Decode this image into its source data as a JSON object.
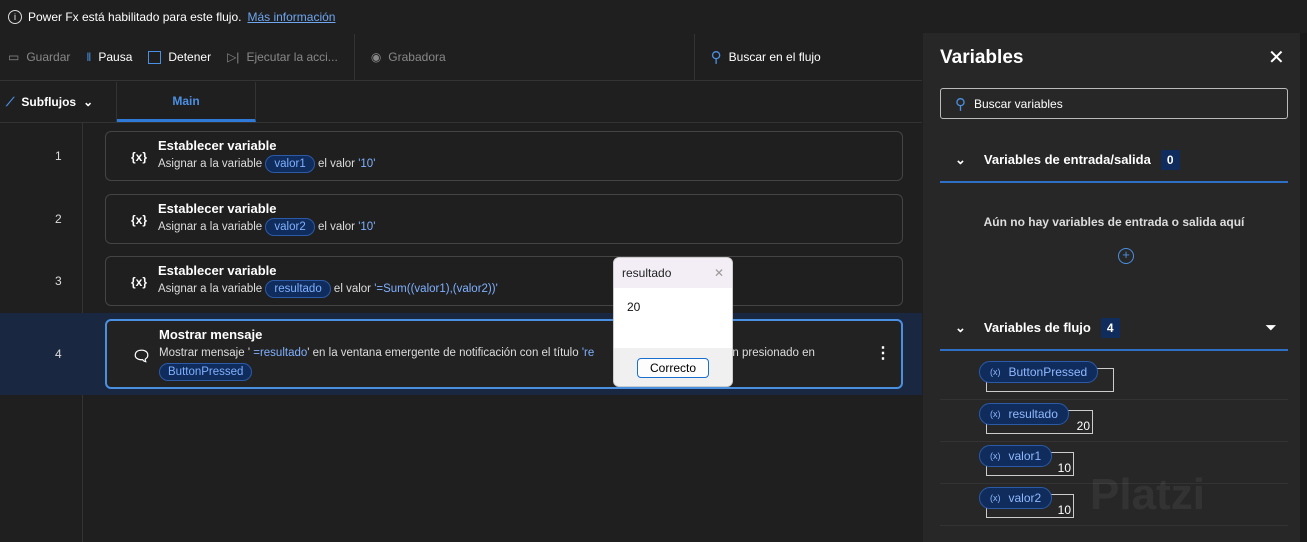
{
  "infobar": {
    "text": "Power Fx está habilitado para este flujo.",
    "link": "Más información"
  },
  "toolbar": {
    "save": "Guardar",
    "pause": "Pausa",
    "stop": "Detener",
    "run": "Ejecutar la acci...",
    "recorder": "Grabadora",
    "search": "Buscar en el flujo"
  },
  "tabs": {
    "subflows": "Subflujos",
    "main": "Main"
  },
  "actions": [
    {
      "num": "1",
      "icon": "{x}",
      "title": "Establecer variable",
      "pre": "Asignar a la variable",
      "var": "valor1",
      "mid": "el valor",
      "val": "'10'"
    },
    {
      "num": "2",
      "icon": "{x}",
      "title": "Establecer variable",
      "pre": "Asignar a la variable",
      "var": "valor2",
      "mid": "el valor",
      "val": "'10'"
    },
    {
      "num": "3",
      "icon": "{x}",
      "title": "Establecer variable",
      "pre": "Asignar a la variable",
      "var": "resultado",
      "mid": "el valor",
      "val": "'=Sum((valor1),(valor2))'"
    }
  ],
  "action4": {
    "num": "4",
    "title": "Mostrar mensaje",
    "pre": "Mostrar mensaje '",
    "expr": " =resultado",
    "post": "' en la ventana emergente de notificación con el título",
    "t": "'re",
    "end": "l botón presionado en",
    "var": "ButtonPressed"
  },
  "dialog": {
    "title": "resultado",
    "body": "20",
    "ok": "Correcto"
  },
  "panel": {
    "title": "Variables",
    "search": "Buscar variables",
    "io": {
      "label": "Variables de entrada/salida",
      "count": "0",
      "empty": "Aún no hay variables de entrada o salida aquí"
    },
    "flow": {
      "label": "Variables de flujo",
      "count": "4",
      "vars": [
        {
          "name": "ButtonPressed",
          "value": ""
        },
        {
          "name": "resultado",
          "value": "20"
        },
        {
          "name": "valor1",
          "value": "10"
        },
        {
          "name": "valor2",
          "value": "10"
        }
      ]
    }
  },
  "watermark": "Platzi"
}
